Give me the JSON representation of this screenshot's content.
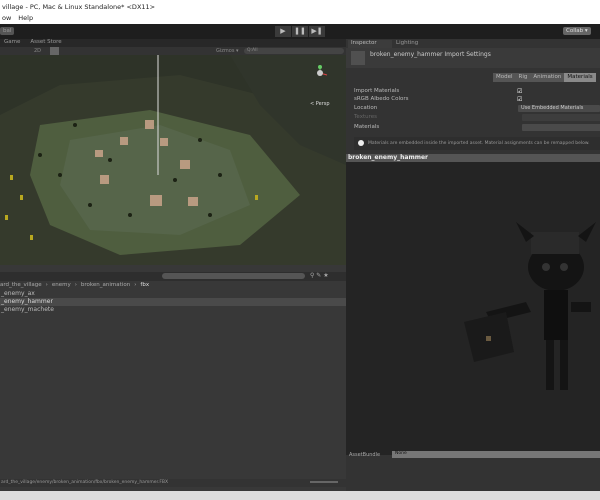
{
  "window": {
    "title": "village - PC, Mac & Linux Standalone* <DX11>"
  },
  "menu": [
    "ow",
    "Help"
  ],
  "toolbar": {
    "global_label": "bal",
    "play": "▶",
    "pause": "❚❚",
    "step": "▶❚",
    "collab": "Collab ▾"
  },
  "scene": {
    "tabs": [
      "Game",
      "Asset Store"
    ],
    "mode": "2D",
    "gizmos": "Gizmos ▾",
    "search": "Q:All",
    "persp": "< Persp"
  },
  "project": {
    "breadcrumb": [
      "ard_the_village",
      "enemy",
      "broken_animation",
      "fbx"
    ],
    "items": [
      "_enemy_ax",
      "_enemy_hammer",
      "_enemy_machete"
    ],
    "selected": 1,
    "path": "ard_the_village/enemy/broken_animation/fbx/broken_enemy_hammer.FBX"
  },
  "inspector": {
    "tabs": [
      "Inspector",
      "Lighting"
    ],
    "header": "broken_enemy_hammer Import Settings",
    "import_tabs": [
      "Model",
      "Rig",
      "Animation",
      "Materials"
    ],
    "active_import_tab": 3,
    "rows": {
      "import_materials": "Import Materials",
      "srgb": "sRGB Albedo Colors",
      "location": "Location",
      "location_value": "Use Embedded Materials",
      "textures": "Textures",
      "materials": "Materials"
    },
    "info": "Materials are embedded inside the imported asset. Material assignments can be remapped below.",
    "preview_title": "broken_enemy_hammer",
    "assetbundle_label": "AssetBundle",
    "assetbundle_value": "None"
  },
  "colors": {
    "accent": "#3e7ce0",
    "terrain": "#4a5a3c"
  }
}
